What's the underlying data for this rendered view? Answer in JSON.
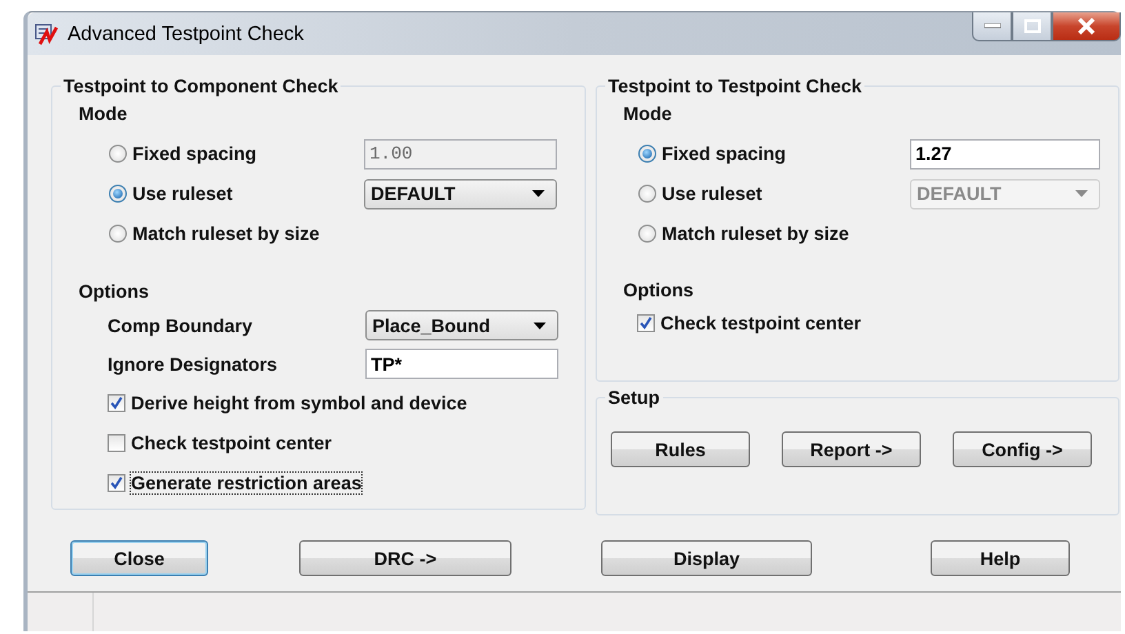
{
  "window": {
    "title": "Advanced Testpoint Check"
  },
  "component_check": {
    "title": "Testpoint to Component Check",
    "mode_label": "Mode",
    "modes": [
      {
        "label": "Fixed spacing",
        "selected": false,
        "control": {
          "kind": "field",
          "value": "1.00",
          "disabled": true
        }
      },
      {
        "label": "Use ruleset",
        "selected": true,
        "control": {
          "kind": "dropdown",
          "value": "DEFAULT",
          "disabled": false
        }
      },
      {
        "label": "Match ruleset by size",
        "selected": false
      }
    ],
    "options_label": "Options",
    "fields": [
      {
        "kind": "dropdown",
        "label": "Comp Boundary",
        "value": "Place_Bound"
      },
      {
        "kind": "field",
        "label": "Ignore Designators",
        "value": "TP*"
      }
    ],
    "checkboxes": [
      {
        "label": "Derive height from symbol and device",
        "checked": true,
        "focused": false
      },
      {
        "label": "Check testpoint center",
        "checked": false,
        "focused": false
      },
      {
        "label": "Generate restriction areas",
        "checked": true,
        "focused": true
      }
    ]
  },
  "testpoint_check": {
    "title": "Testpoint to Testpoint Check",
    "mode_label": "Mode",
    "modes": [
      {
        "label": "Fixed spacing",
        "selected": true,
        "control": {
          "kind": "field",
          "value": "1.27",
          "disabled": false
        }
      },
      {
        "label": "Use ruleset",
        "selected": false,
        "control": {
          "kind": "dropdown",
          "value": "DEFAULT",
          "disabled": true
        }
      },
      {
        "label": "Match ruleset by size",
        "selected": false
      }
    ],
    "options_label": "Options",
    "checkboxes": [
      {
        "label": "Check testpoint center",
        "checked": true,
        "focused": false
      }
    ]
  },
  "setup": {
    "title": "Setup",
    "buttons": [
      "Rules",
      "Report ->",
      "Config ->"
    ]
  },
  "buttons": [
    {
      "label": "Close",
      "default": true
    },
    {
      "label": "DRC ->",
      "default": false
    },
    {
      "label": "Display",
      "default": false
    },
    {
      "label": "Help",
      "default": false
    }
  ]
}
